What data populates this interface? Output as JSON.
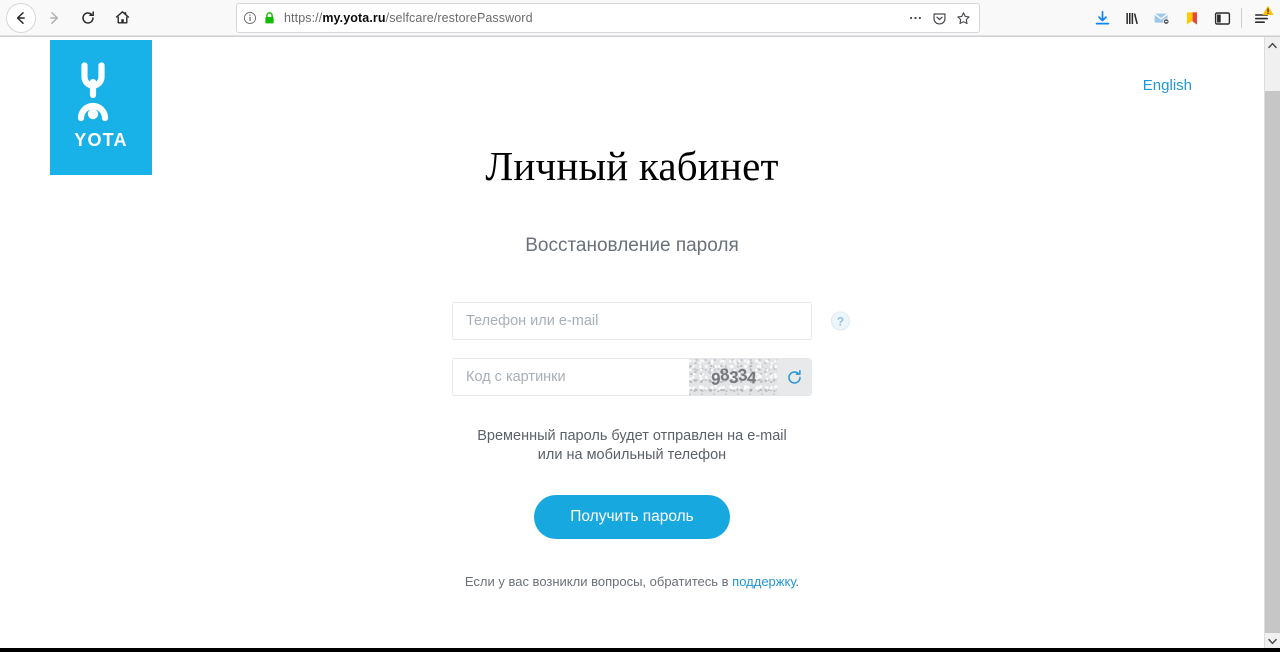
{
  "browser": {
    "nav": {
      "back_label": "Back",
      "forward_label": "Forward",
      "reload_label": "Reload",
      "home_label": "Home"
    },
    "url": {
      "scheme": "https://",
      "host": "my.yota.ru",
      "path": "/selfcare/restorePassword",
      "full": "https://my.yota.ru/selfcare/restorePassword",
      "connection_secure": true
    },
    "urlbar_icons": [
      "page-info-icon",
      "lock-icon",
      "page-actions-icon",
      "pocket-icon",
      "bookmark-star-icon"
    ],
    "toolbar_icons": [
      "downloads-icon",
      "library-icon",
      "email-icon",
      "bookmark-flag-icon",
      "sidebar-icon",
      "app-menu-icon"
    ],
    "menu_has_warning_badge": true
  },
  "page": {
    "logo": {
      "word": "YOTA",
      "background_color": "#18b1e8",
      "mark_color": "#ffffff"
    },
    "lang_switch": {
      "label": "English",
      "color": "#2196d6"
    },
    "title": "Личный кабинет",
    "subtitle": "Восстановление пароля",
    "form": {
      "login_field": {
        "placeholder": "Телефон или e-mail",
        "value": ""
      },
      "help_badge": "?",
      "captcha_field": {
        "placeholder": "Код с картинки",
        "value": ""
      },
      "captcha_code": "98334",
      "captcha_refresh_label": "Обновить код"
    },
    "hint_line1": "Временный пароль будет отправлен на e-mail",
    "hint_line2": "или на мобильный телефон",
    "submit_label": "Получить пароль",
    "support": {
      "prefix": "Если у вас возникли вопросы, обратитесь в ",
      "link": "поддержку",
      "suffix": "."
    },
    "accent_color": "#18a8e0",
    "link_color": "#2196d6"
  }
}
